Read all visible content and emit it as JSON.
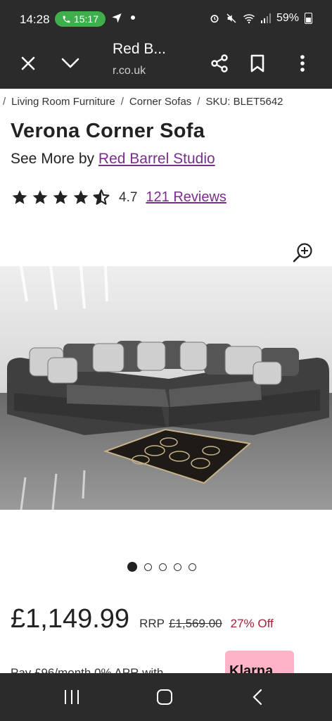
{
  "status_bar": {
    "time": "14:28",
    "call_time": "15:17",
    "battery": "59%"
  },
  "browser": {
    "title": "Red B...",
    "url": "r.co.uk"
  },
  "breadcrumb": {
    "items": [
      "Living Room Furniture",
      "Corner Sofas"
    ],
    "sku": "SKU: BLET5642"
  },
  "product": {
    "title": "Verona Corner Sofa",
    "see_more_prefix": "See More by",
    "brand": "Red Barrel Studio",
    "rating_value": "4.7",
    "rating": 4.7,
    "reviews": "121 Reviews",
    "price": "£1,149.99",
    "rrp_label": "RRP",
    "rrp_value": "£1,569.00",
    "discount": "27% Off",
    "klarna_label": "Klarna",
    "finance_text": "Pay £96/month 0% APR with"
  },
  "gallery": {
    "image_count": 5,
    "active_index": 0
  },
  "colors": {
    "brand_purple": "#7b2d8e",
    "discount_red": "#a6213a",
    "klarna_pink": "#ffb3c7",
    "bar_dark": "#2b2b2b"
  }
}
